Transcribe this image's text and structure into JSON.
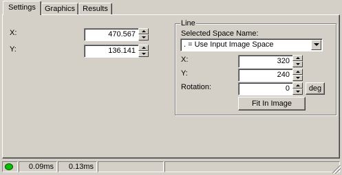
{
  "tabs": [
    {
      "label": "Settings",
      "active": true
    },
    {
      "label": "Graphics",
      "active": false
    },
    {
      "label": "Results",
      "active": false
    }
  ],
  "settings": {
    "x_label": "X:",
    "x_value": "470.567",
    "y_label": "Y:",
    "y_value": "136.141"
  },
  "line_group": {
    "title": "Line",
    "selected_space_label": "Selected Space Name:",
    "selected_space_value": ". = Use Input Image Space",
    "x_label": "X:",
    "x_value": "320",
    "y_label": "Y:",
    "y_value": "240",
    "rotation_label": "Rotation:",
    "rotation_value": "0",
    "deg_button": "deg",
    "fit_button": "Fit In Image"
  },
  "status": {
    "indicator_color": "#00c000",
    "time1": "0.09ms",
    "time2": "0.13ms",
    "cell3": "",
    "cell4": ""
  },
  "icons": {
    "spin_up": "triangle-up-icon",
    "spin_down": "triangle-down-icon",
    "dropdown": "chevron-down-icon",
    "status_led": "green-led-icon",
    "size_grip": "resize-grip-icon"
  }
}
